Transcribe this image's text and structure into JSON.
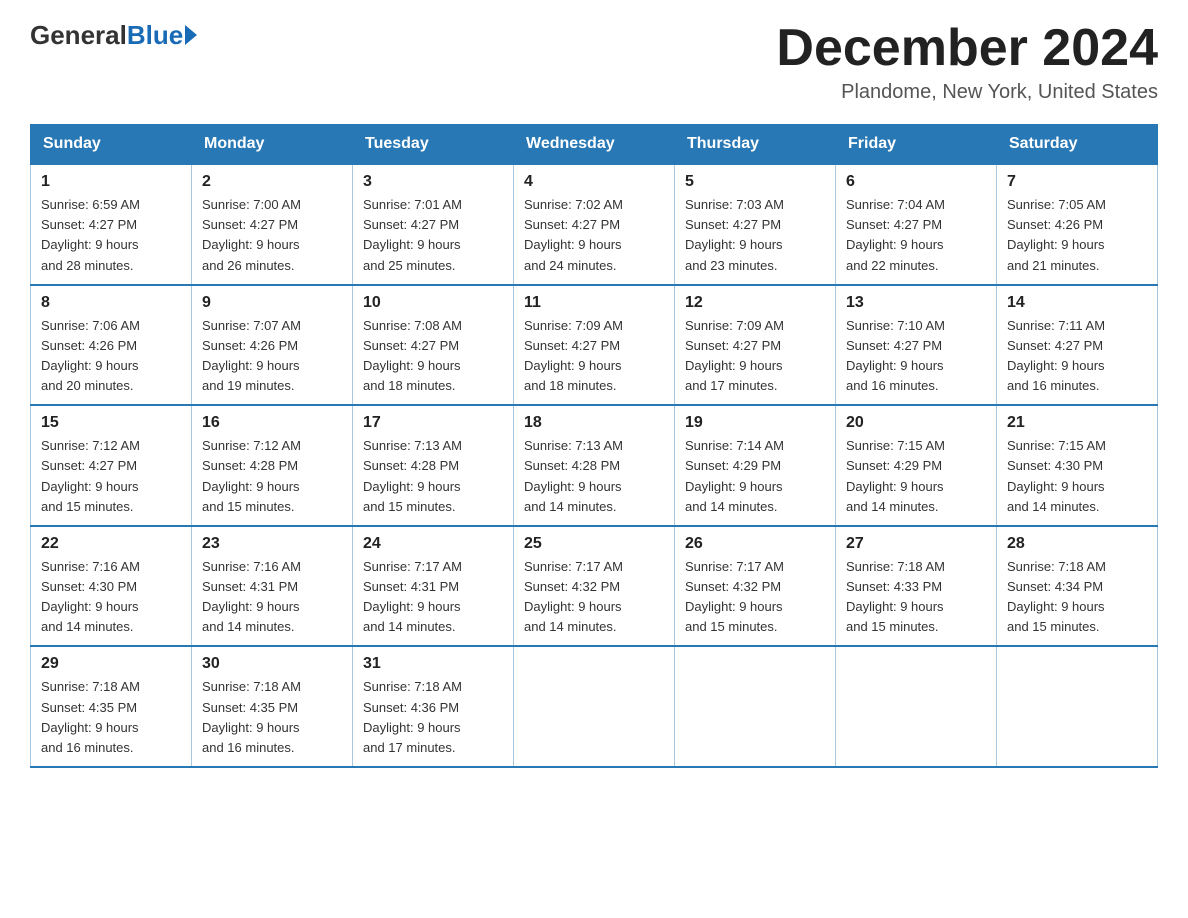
{
  "header": {
    "logo_general": "General",
    "logo_blue": "Blue",
    "month_title": "December 2024",
    "location": "Plandome, New York, United States"
  },
  "days_of_week": [
    "Sunday",
    "Monday",
    "Tuesday",
    "Wednesday",
    "Thursday",
    "Friday",
    "Saturday"
  ],
  "weeks": [
    [
      {
        "day": "1",
        "sunrise": "6:59 AM",
        "sunset": "4:27 PM",
        "daylight": "9 hours and 28 minutes."
      },
      {
        "day": "2",
        "sunrise": "7:00 AM",
        "sunset": "4:27 PM",
        "daylight": "9 hours and 26 minutes."
      },
      {
        "day": "3",
        "sunrise": "7:01 AM",
        "sunset": "4:27 PM",
        "daylight": "9 hours and 25 minutes."
      },
      {
        "day": "4",
        "sunrise": "7:02 AM",
        "sunset": "4:27 PM",
        "daylight": "9 hours and 24 minutes."
      },
      {
        "day": "5",
        "sunrise": "7:03 AM",
        "sunset": "4:27 PM",
        "daylight": "9 hours and 23 minutes."
      },
      {
        "day": "6",
        "sunrise": "7:04 AM",
        "sunset": "4:27 PM",
        "daylight": "9 hours and 22 minutes."
      },
      {
        "day": "7",
        "sunrise": "7:05 AM",
        "sunset": "4:26 PM",
        "daylight": "9 hours and 21 minutes."
      }
    ],
    [
      {
        "day": "8",
        "sunrise": "7:06 AM",
        "sunset": "4:26 PM",
        "daylight": "9 hours and 20 minutes."
      },
      {
        "day": "9",
        "sunrise": "7:07 AM",
        "sunset": "4:26 PM",
        "daylight": "9 hours and 19 minutes."
      },
      {
        "day": "10",
        "sunrise": "7:08 AM",
        "sunset": "4:27 PM",
        "daylight": "9 hours and 18 minutes."
      },
      {
        "day": "11",
        "sunrise": "7:09 AM",
        "sunset": "4:27 PM",
        "daylight": "9 hours and 18 minutes."
      },
      {
        "day": "12",
        "sunrise": "7:09 AM",
        "sunset": "4:27 PM",
        "daylight": "9 hours and 17 minutes."
      },
      {
        "day": "13",
        "sunrise": "7:10 AM",
        "sunset": "4:27 PM",
        "daylight": "9 hours and 16 minutes."
      },
      {
        "day": "14",
        "sunrise": "7:11 AM",
        "sunset": "4:27 PM",
        "daylight": "9 hours and 16 minutes."
      }
    ],
    [
      {
        "day": "15",
        "sunrise": "7:12 AM",
        "sunset": "4:27 PM",
        "daylight": "9 hours and 15 minutes."
      },
      {
        "day": "16",
        "sunrise": "7:12 AM",
        "sunset": "4:28 PM",
        "daylight": "9 hours and 15 minutes."
      },
      {
        "day": "17",
        "sunrise": "7:13 AM",
        "sunset": "4:28 PM",
        "daylight": "9 hours and 15 minutes."
      },
      {
        "day": "18",
        "sunrise": "7:13 AM",
        "sunset": "4:28 PM",
        "daylight": "9 hours and 14 minutes."
      },
      {
        "day": "19",
        "sunrise": "7:14 AM",
        "sunset": "4:29 PM",
        "daylight": "9 hours and 14 minutes."
      },
      {
        "day": "20",
        "sunrise": "7:15 AM",
        "sunset": "4:29 PM",
        "daylight": "9 hours and 14 minutes."
      },
      {
        "day": "21",
        "sunrise": "7:15 AM",
        "sunset": "4:30 PM",
        "daylight": "9 hours and 14 minutes."
      }
    ],
    [
      {
        "day": "22",
        "sunrise": "7:16 AM",
        "sunset": "4:30 PM",
        "daylight": "9 hours and 14 minutes."
      },
      {
        "day": "23",
        "sunrise": "7:16 AM",
        "sunset": "4:31 PM",
        "daylight": "9 hours and 14 minutes."
      },
      {
        "day": "24",
        "sunrise": "7:17 AM",
        "sunset": "4:31 PM",
        "daylight": "9 hours and 14 minutes."
      },
      {
        "day": "25",
        "sunrise": "7:17 AM",
        "sunset": "4:32 PM",
        "daylight": "9 hours and 14 minutes."
      },
      {
        "day": "26",
        "sunrise": "7:17 AM",
        "sunset": "4:32 PM",
        "daylight": "9 hours and 15 minutes."
      },
      {
        "day": "27",
        "sunrise": "7:18 AM",
        "sunset": "4:33 PM",
        "daylight": "9 hours and 15 minutes."
      },
      {
        "day": "28",
        "sunrise": "7:18 AM",
        "sunset": "4:34 PM",
        "daylight": "9 hours and 15 minutes."
      }
    ],
    [
      {
        "day": "29",
        "sunrise": "7:18 AM",
        "sunset": "4:35 PM",
        "daylight": "9 hours and 16 minutes."
      },
      {
        "day": "30",
        "sunrise": "7:18 AM",
        "sunset": "4:35 PM",
        "daylight": "9 hours and 16 minutes."
      },
      {
        "day": "31",
        "sunrise": "7:18 AM",
        "sunset": "4:36 PM",
        "daylight": "9 hours and 17 minutes."
      },
      null,
      null,
      null,
      null
    ]
  ],
  "labels": {
    "sunrise": "Sunrise: ",
    "sunset": "Sunset: ",
    "daylight": "Daylight: "
  }
}
